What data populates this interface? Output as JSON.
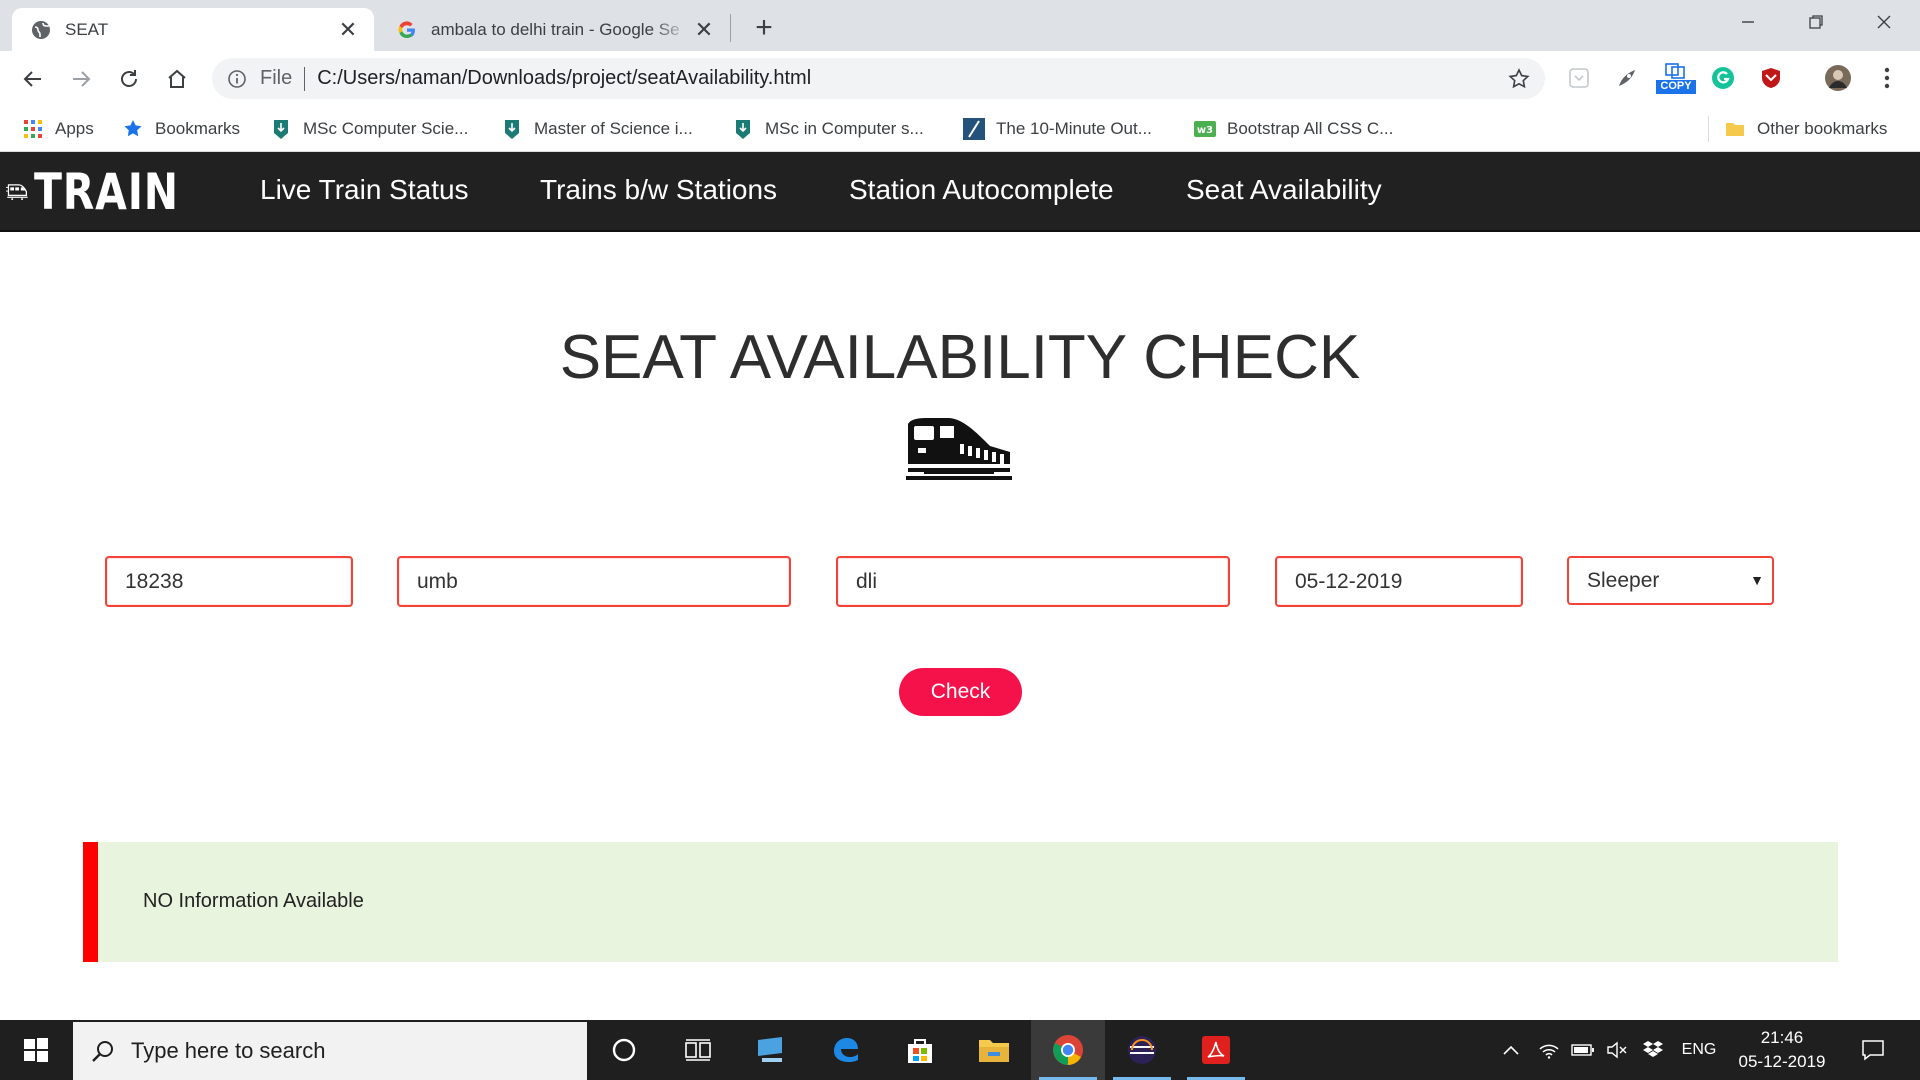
{
  "browser": {
    "tabs": [
      {
        "title": "SEAT",
        "active": true
      },
      {
        "title": "ambala to delhi train - Google Se",
        "active": false
      }
    ],
    "address": {
      "scheme": "File",
      "url": "C:/Users/naman/Downloads/project/seatAvailability.html"
    },
    "extensions": {
      "copy_label": "COPY"
    },
    "bookmarks": [
      {
        "label": "Apps",
        "icon": "apps-grid-icon"
      },
      {
        "label": "Bookmarks",
        "icon": "star-icon"
      },
      {
        "label": "MSc Computer Scie...",
        "icon": "pen-nib-icon"
      },
      {
        "label": "Master of Science i...",
        "icon": "pen-nib-icon"
      },
      {
        "label": "MSc in Computer s...",
        "icon": "pen-nib-icon"
      },
      {
        "label": "The 10-Minute Out...",
        "icon": "slash-icon"
      },
      {
        "label": "Bootstrap All CSS C...",
        "icon": "w3-icon"
      }
    ],
    "other_bookmarks": "Other bookmarks"
  },
  "site": {
    "logo_text": "TRAIN",
    "nav": [
      "Live Train Status",
      "Trains b/w Stations",
      "Station Autocomplete",
      "Seat Availability"
    ],
    "heading": "SEAT AVAILABILITY CHECK",
    "form": {
      "train_number": "18238",
      "source": "umb",
      "destination": "dli",
      "date": "05-12-2019",
      "class_selected": "Sleeper",
      "submit_label": "Check"
    },
    "result_message": "NO Information Available"
  },
  "taskbar": {
    "search_placeholder": "Type here to search",
    "language": "ENG",
    "time": "21:46",
    "date": "05-12-2019"
  },
  "colors": {
    "accent": "#f5124a",
    "field_border": "#f44336",
    "nav_bg": "#212121",
    "result_bg": "#e9f4de",
    "result_bar": "#ff0000"
  }
}
